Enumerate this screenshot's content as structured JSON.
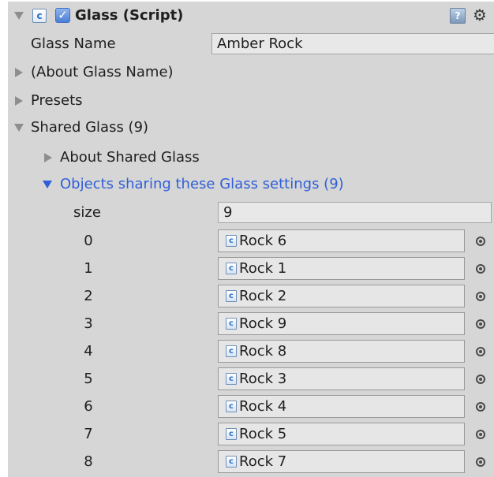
{
  "header": {
    "title": "Glass (Script)",
    "script_icon": "script-icon",
    "checkbox_checked": true,
    "help_icon": "help-icon",
    "gear_icon": "gear-icon"
  },
  "glass_name": {
    "label": "Glass Name",
    "value": "Amber Rock"
  },
  "sections": {
    "about_glass_name": "(About Glass Name)",
    "presets": "Presets",
    "shared_glass": "Shared Glass (9)",
    "about_shared_glass": "About Shared Glass",
    "objects_sharing": "Objects sharing these Glass settings (9)"
  },
  "array": {
    "size_label": "size",
    "size_value": "9",
    "items": [
      {
        "index": "0",
        "value": "Rock 6"
      },
      {
        "index": "1",
        "value": "Rock 1"
      },
      {
        "index": "2",
        "value": "Rock 2"
      },
      {
        "index": "3",
        "value": "Rock 9"
      },
      {
        "index": "4",
        "value": "Rock 8"
      },
      {
        "index": "5",
        "value": "Rock 3"
      },
      {
        "index": "6",
        "value": "Rock 4"
      },
      {
        "index": "7",
        "value": "Rock 5"
      },
      {
        "index": "8",
        "value": "Rock 7"
      }
    ]
  },
  "colors": {
    "panel_bg": "#d6d6d6",
    "accent_blue": "#2f5ed8",
    "field_bg": "#e8e8e8",
    "text": "#1e1e1e"
  }
}
